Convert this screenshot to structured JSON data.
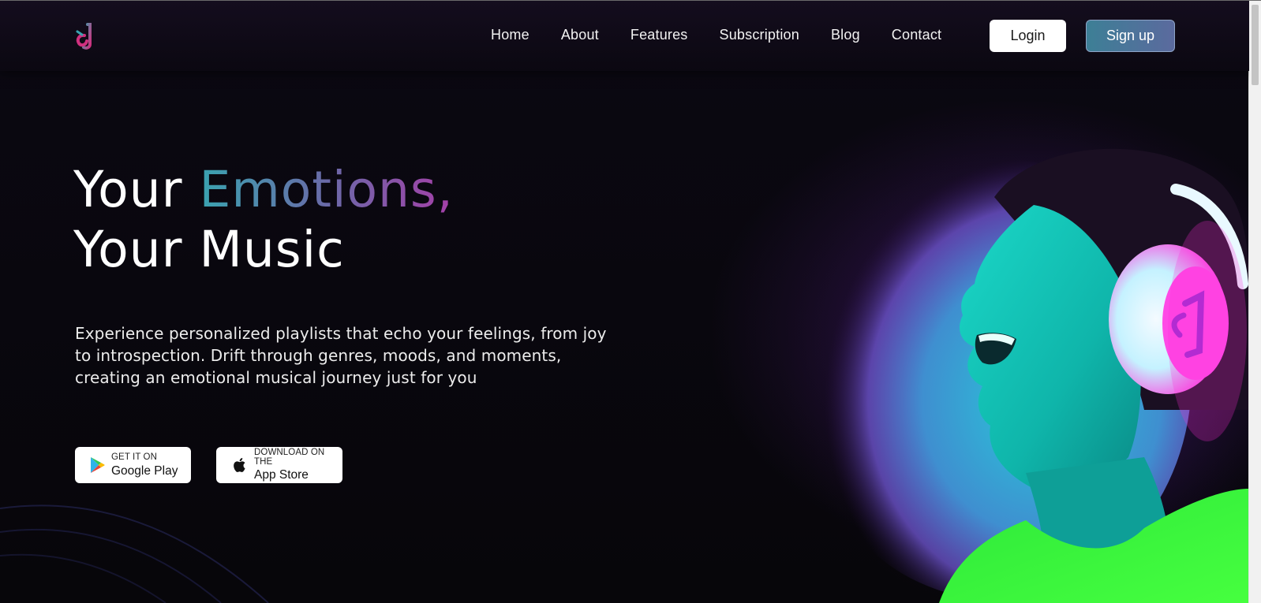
{
  "nav": {
    "links": [
      "Home",
      "About",
      "Features",
      "Subscription",
      "Blog",
      "Contact"
    ],
    "login_label": "Login",
    "signup_label": "Sign up"
  },
  "hero": {
    "title_prefix": "Your ",
    "title_highlight": "Emotions,",
    "title_line2": "Your Music",
    "description": "Experience personalized playlists that echo your feelings, from joy to introspection. Drift through genres, moods, and moments, creating an emotional musical journey just for you"
  },
  "stores": {
    "google_play": {
      "small": "GET IT ON",
      "big": "Google Play",
      "icon": "google-play-icon"
    },
    "app_store": {
      "small": "DOWNLOAD ON THE",
      "big": "App Store",
      "icon": "apple-icon"
    }
  },
  "colors": {
    "accent_teal": "#3aa3b0",
    "accent_purple": "#a53fa8",
    "background": "#07060a",
    "glow_pink": "#ff2ad8",
    "glow_cyan": "#12e6d6",
    "hoodie_green": "#39ff3c"
  }
}
